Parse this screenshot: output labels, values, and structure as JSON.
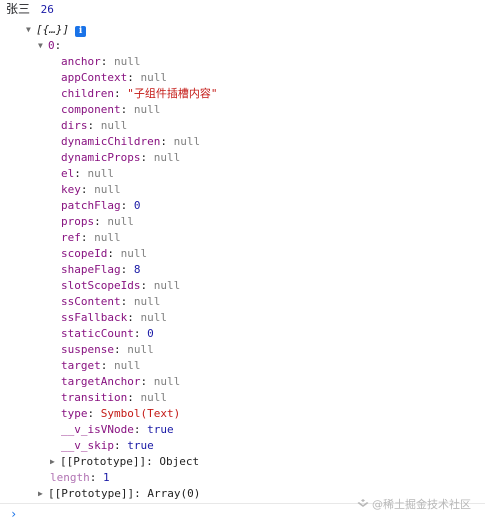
{
  "log": {
    "name": "张三",
    "age": "26"
  },
  "array_preview": "[{…}]",
  "info_badge": "i",
  "item_index": "0",
  "props": [
    {
      "key": "anchor",
      "value": "null",
      "kind": "null"
    },
    {
      "key": "appContext",
      "value": "null",
      "kind": "null"
    },
    {
      "key": "children",
      "value": "\"子组件插槽内容\"",
      "kind": "str"
    },
    {
      "key": "component",
      "value": "null",
      "kind": "null"
    },
    {
      "key": "dirs",
      "value": "null",
      "kind": "null"
    },
    {
      "key": "dynamicChildren",
      "value": "null",
      "kind": "null"
    },
    {
      "key": "dynamicProps",
      "value": "null",
      "kind": "null"
    },
    {
      "key": "el",
      "value": "null",
      "kind": "null"
    },
    {
      "key": "key",
      "value": "null",
      "kind": "null"
    },
    {
      "key": "patchFlag",
      "value": "0",
      "kind": "num"
    },
    {
      "key": "props",
      "value": "null",
      "kind": "null"
    },
    {
      "key": "ref",
      "value": "null",
      "kind": "null"
    },
    {
      "key": "scopeId",
      "value": "null",
      "kind": "null"
    },
    {
      "key": "shapeFlag",
      "value": "8",
      "kind": "num"
    },
    {
      "key": "slotScopeIds",
      "value": "null",
      "kind": "null"
    },
    {
      "key": "ssContent",
      "value": "null",
      "kind": "null"
    },
    {
      "key": "ssFallback",
      "value": "null",
      "kind": "null"
    },
    {
      "key": "staticCount",
      "value": "0",
      "kind": "num"
    },
    {
      "key": "suspense",
      "value": "null",
      "kind": "null"
    },
    {
      "key": "target",
      "value": "null",
      "kind": "null"
    },
    {
      "key": "targetAnchor",
      "value": "null",
      "kind": "null"
    },
    {
      "key": "transition",
      "value": "null",
      "kind": "null"
    },
    {
      "key": "type",
      "value": "Symbol(Text)",
      "kind": "sym"
    },
    {
      "key": "__v_isVNode",
      "value": "true",
      "kind": "bool"
    },
    {
      "key": "__v_skip",
      "value": "true",
      "kind": "bool"
    }
  ],
  "item_prototype": {
    "key": "[[Prototype]]",
    "value": "Object"
  },
  "length": {
    "key": "length",
    "value": "1"
  },
  "array_prototype": {
    "key": "[[Prototype]]",
    "value": "Array(0)"
  },
  "prompt_symbol": "›",
  "watermark": "@稀土掘金技术社区"
}
